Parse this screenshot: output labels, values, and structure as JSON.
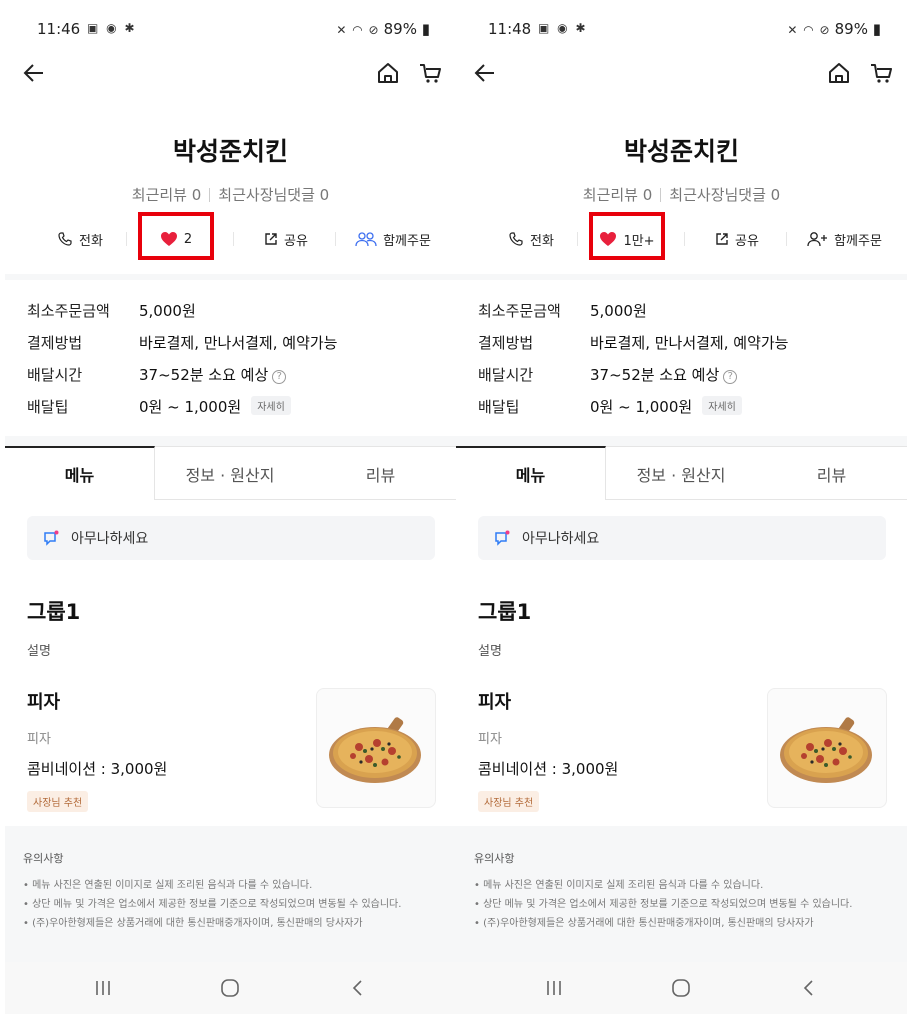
{
  "colors": {
    "heart": "#e8203c",
    "highlight": "#e8000b",
    "group_icon": "#3d6ff0",
    "notice_icon_blue": "#2f7df6",
    "notice_icon_pink": "#f03e8a"
  },
  "icons": {
    "back": "arrow-left-icon",
    "home": "home-icon",
    "cart": "cart-icon",
    "call": "phone-icon",
    "like": "heart-icon",
    "share": "share-icon",
    "group": "group-users-icon",
    "notice": "speaker-notice-icon"
  },
  "screens": [
    {
      "status": {
        "time": "11:46",
        "battery": "89%"
      },
      "store": {
        "name": "박성준치킨",
        "recent_reviews": "최근리뷰 0",
        "owner_comments": "최근사장님댓글 0"
      },
      "actions": {
        "call": "전화",
        "like_count": "2",
        "share": "공유",
        "group_order": "함께주문"
      },
      "info": [
        {
          "label": "최소주문금액",
          "value": "5,000원"
        },
        {
          "label": "결제방법",
          "value": "바로결제, 만나서결제, 예약가능"
        },
        {
          "label": "배달시간",
          "value": "37~52분 소요 예상"
        },
        {
          "label": "배달팁",
          "value": "0원 ~ 1,000원",
          "badge": "자세히"
        }
      ],
      "tabs": [
        "메뉴",
        "정보 · 원산지",
        "리뷰"
      ],
      "notice": "아무나하세요",
      "group": {
        "title": "그룹1",
        "desc": "설명"
      },
      "item": {
        "name": "피자",
        "sub": "피자",
        "price": "콤비네이션 : 3,000원",
        "badge": "사장님 추천"
      },
      "notes": {
        "title": "유의사항",
        "lines": [
          "• 메뉴 사진은 연출된 이미지로 실제 조리된 음식과 다를 수 있습니다.",
          "• 상단 메뉴 및 가격은 업소에서 제공한 정보를 기준으로 작성되었으며 변동될 수 있습니다.",
          "• (주)우아한형제들은 상품거래에 대한 통신판매중개자이며, 통신판매의 당사자가"
        ]
      }
    },
    {
      "status": {
        "time": "11:48",
        "battery": "89%"
      },
      "store": {
        "name": "박성준치킨",
        "recent_reviews": "최근리뷰 0",
        "owner_comments": "최근사장님댓글 0"
      },
      "actions": {
        "call": "전화",
        "like_count": "1만+",
        "share": "공유",
        "group_order": "함께주문"
      },
      "info": [
        {
          "label": "최소주문금액",
          "value": "5,000원"
        },
        {
          "label": "결제방법",
          "value": "바로결제, 만나서결제, 예약가능"
        },
        {
          "label": "배달시간",
          "value": "37~52분 소요 예상"
        },
        {
          "label": "배달팁",
          "value": "0원 ~ 1,000원",
          "badge": "자세히"
        }
      ],
      "tabs": [
        "메뉴",
        "정보 · 원산지",
        "리뷰"
      ],
      "notice": "아무나하세요",
      "group": {
        "title": "그룹1",
        "desc": "설명"
      },
      "item": {
        "name": "피자",
        "sub": "피자",
        "price": "콤비네이션 : 3,000원",
        "badge": "사장님 추천"
      },
      "notes": {
        "title": "유의사항",
        "lines": [
          "• 메뉴 사진은 연출된 이미지로 실제 조리된 음식과 다를 수 있습니다.",
          "• 상단 메뉴 및 가격은 업소에서 제공한 정보를 기준으로 작성되었으며 변동될 수 있습니다.",
          "• (주)우아한형제들은 상품거래에 대한 통신판매중개자이며, 통신판매의 당사자가"
        ]
      }
    }
  ]
}
